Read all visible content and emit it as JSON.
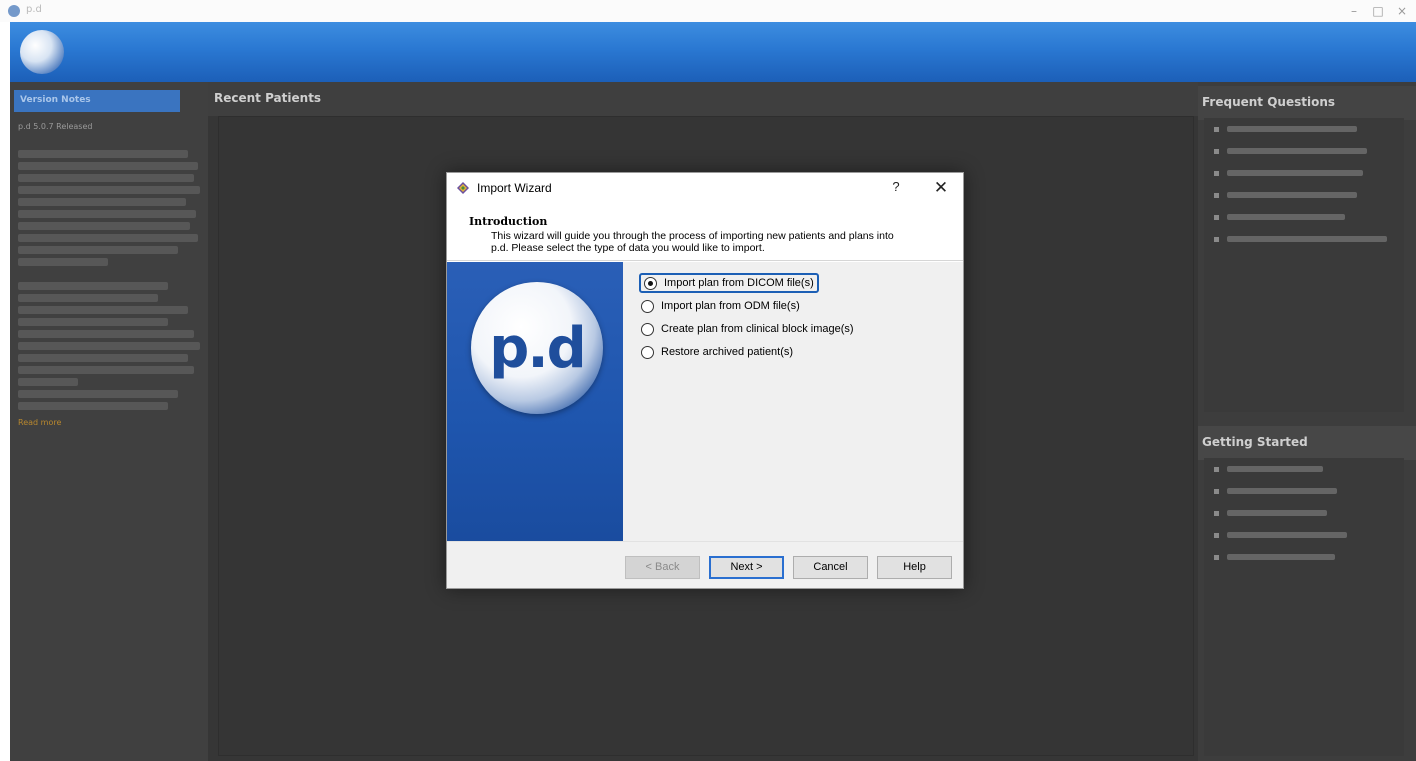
{
  "window": {
    "title": "p.d",
    "minimize": "–",
    "maximize": "□",
    "close": "×"
  },
  "banner": {
    "logo_text": "",
    "logo_sub": ""
  },
  "left_panel": {
    "header": "Version Notes",
    "title": "p.d 5.0.7 Released",
    "subtitle": "",
    "link": "Read more"
  },
  "center_panel": {
    "header": "Recent Patients"
  },
  "right_panel": {
    "faq_header": "Frequent Questions",
    "getting_started_header": "Getting Started",
    "faq_count": 6,
    "getting_started_count": 5
  },
  "dialog": {
    "title": "Import Wizard",
    "help": "?",
    "close": "✕",
    "intro_title": "Introduction",
    "intro_desc_1": "This wizard will guide you through the process of importing new patients and plans into",
    "intro_desc_2": "p.d. Please select the type of data you would like to import.",
    "logo_text": "p.d",
    "options": [
      {
        "label": "Import plan from DICOM file(s)",
        "checked": true
      },
      {
        "label": "Import plan from ODM file(s)",
        "checked": false
      },
      {
        "label": "Create plan from clinical block image(s)",
        "checked": false
      },
      {
        "label": "Restore archived patient(s)",
        "checked": false
      }
    ],
    "buttons": {
      "back": "< Back",
      "next": "Next >",
      "cancel": "Cancel",
      "help": "Help"
    }
  },
  "colors": {
    "banner": "#2a78d2",
    "accent": "#1c5fb5",
    "dark_bg": "#3c3c3c"
  }
}
